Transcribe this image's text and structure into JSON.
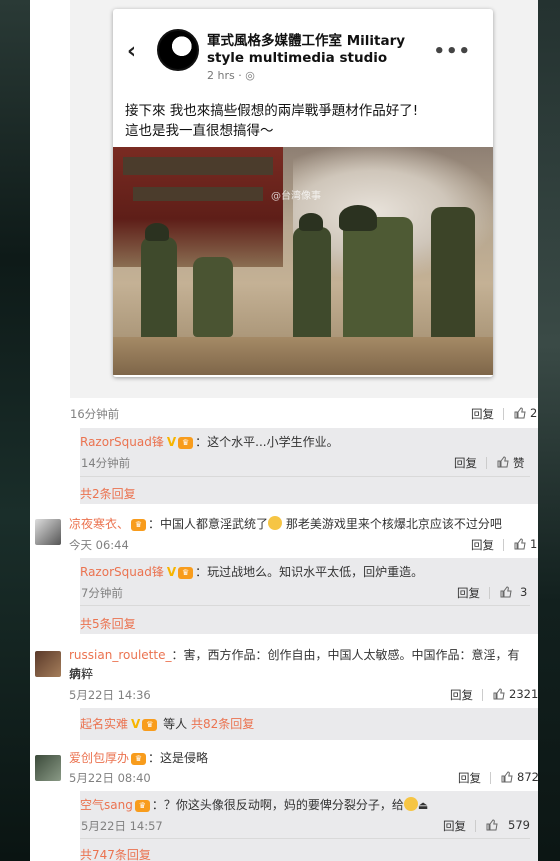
{
  "post_image": {
    "card_name": "軍式風格多媒體工作室 Military style multimedia studio",
    "card_time": "2 hrs · ",
    "card_text": "接下來 我也來搞些假想的兩岸戰爭題材作品好了!\n這也是我一直很想搞得～",
    "watermark": "@台湾像事"
  },
  "post_meta": {
    "time": "16分钟前",
    "reply_label": "回复",
    "like_count": "2"
  },
  "comments": [
    {
      "user": "RazorSquad锋",
      "text": "：这个水平...小学生作业。",
      "time": "14分钟前",
      "reply_label": "回复",
      "like_label": "赞",
      "more": "共2条回复"
    },
    {
      "user": "凉夜寒衣、",
      "text": "：中国人都意淫武统了",
      "text2": "那老美游戏里来个核爆北京应该不过分吧",
      "time": "今天 06:44",
      "reply_label": "回复",
      "like_count": "1",
      "sub": {
        "user": "RazorSquad锋",
        "text": "：玩过战地么。知识水平太低，回炉重造。",
        "time": "7分钟前",
        "reply_label": "回复",
        "like_count": "3",
        "more": "共5条回复"
      }
    },
    {
      "user": "russian_roulette_",
      "text": "：害，西方作品：创作自由，中国人太敏感。中国作品：意淫，有病，",
      "text2": "纳粹",
      "time": "5月22日 14:36",
      "reply_label": "回复",
      "like_count": "2321",
      "sub_more_user": "起名实难",
      "sub_more_mid": "等人",
      "sub_more_count": "共82条回复"
    },
    {
      "user": "爱创包厚办",
      "text": "：这是侵略",
      "time": "5月22日 08:40",
      "reply_label": "回复",
      "like_count": "872",
      "sub": {
        "user": "空气sang",
        "text": "：？你这头像很反动啊，妈的要俾分裂分子，给",
        "time": "5月22日 14:57",
        "reply_label": "回复",
        "like_count": "579",
        "more": "共747条回复"
      }
    }
  ],
  "colors": {
    "username": "#eb7350",
    "vip_badge": "#f89c1c",
    "v_badge": "#f7b500"
  }
}
